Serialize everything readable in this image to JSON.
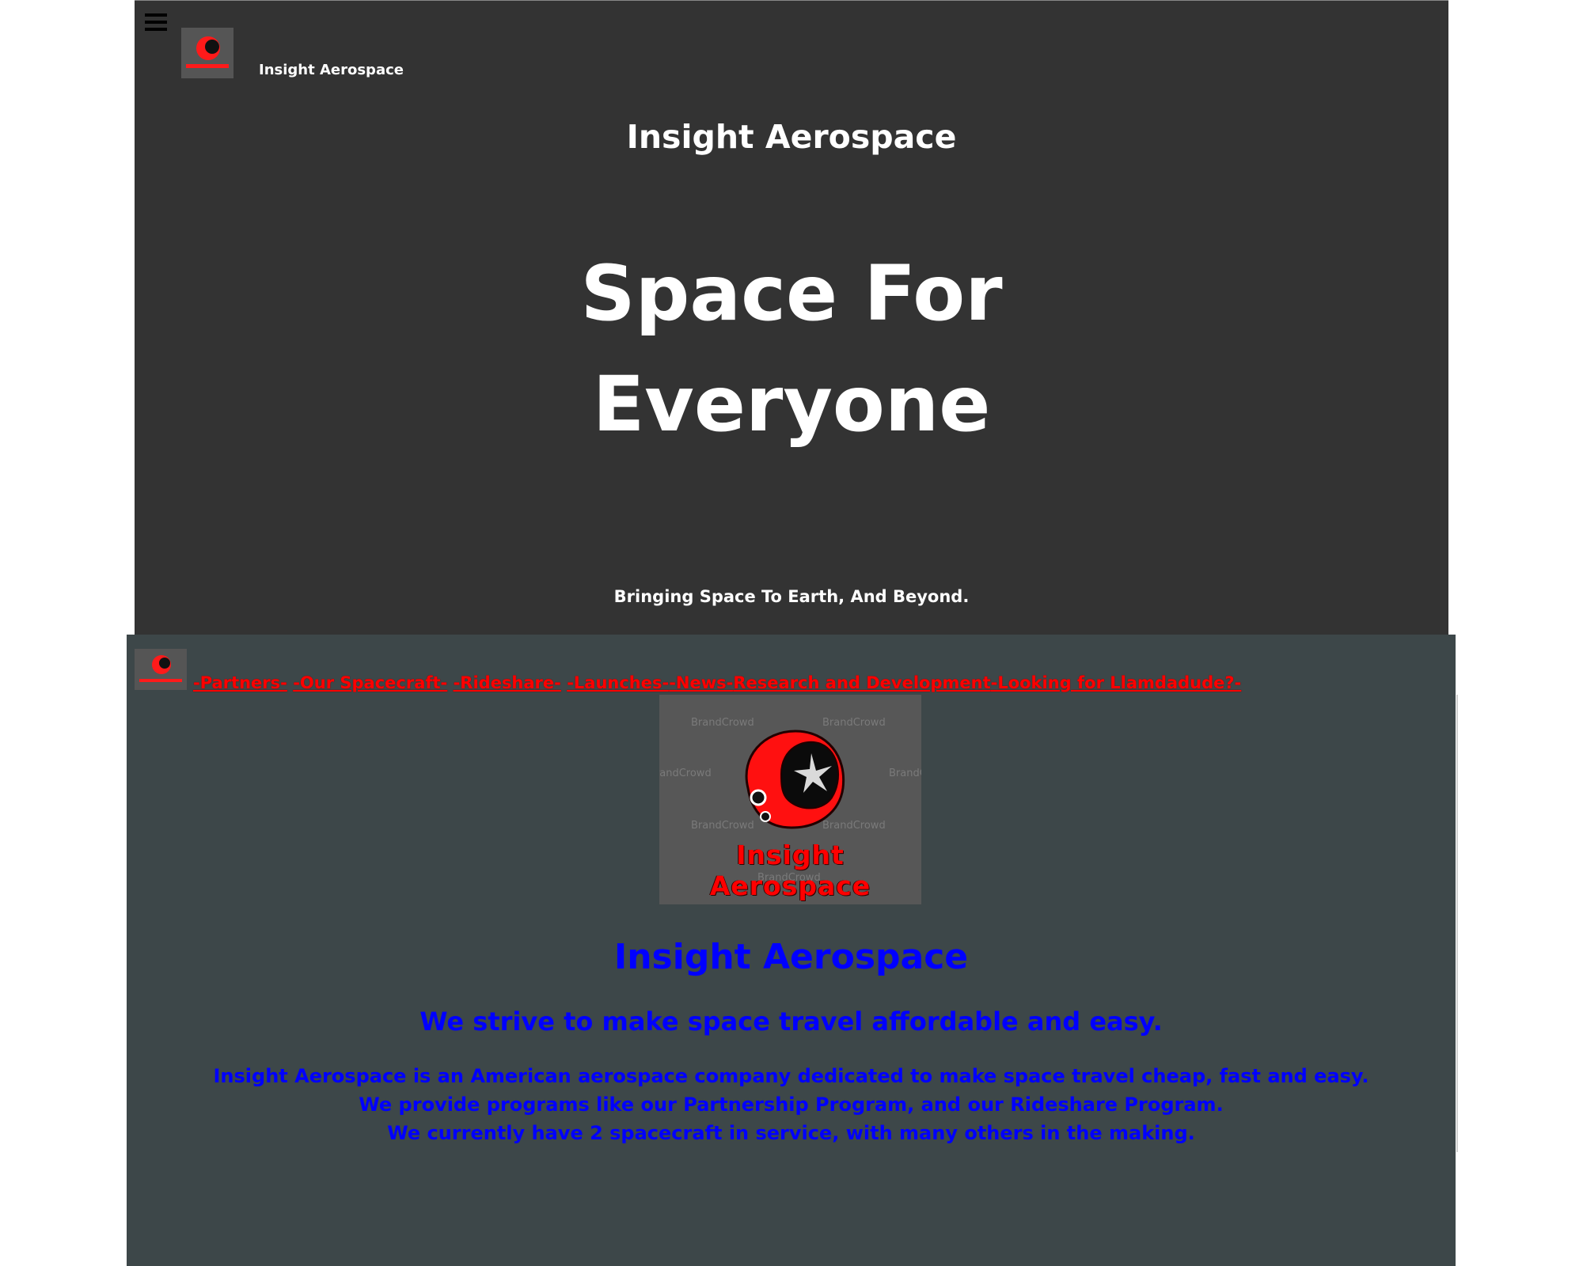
{
  "hero": {
    "brand": "Insight Aerospace",
    "title": "Insight Aerospace",
    "headline_line1": "Space For",
    "headline_line2": "Everyone",
    "tagline": "Bringing Space To Earth, And Beyond."
  },
  "nav": {
    "links": [
      "-Partners-",
      "-Our Spacecraft-",
      "-Rideshare-",
      "-Launches-",
      "-News-",
      "Research and Development",
      "-Looking for Llamdadude?-"
    ]
  },
  "logo": {
    "text": "Insight Aerospace",
    "watermark": "BrandCrowd"
  },
  "about": {
    "title": "Insight Aerospace",
    "subtitle": "We strive to make space travel affordable and easy.",
    "lines": [
      "Insight Aerospace is an American aerospace company dedicated to make space travel cheap, fast and easy.",
      "We provide programs like our Partnership Program, and our Rideshare Program.",
      "We currently have 2 spacecraft in service, with many others in the making."
    ]
  },
  "colors": {
    "hero_bg": "#333333",
    "section_bg": "#3d4749",
    "nav_link": "#ff0000",
    "about_text": "#0000ff"
  }
}
